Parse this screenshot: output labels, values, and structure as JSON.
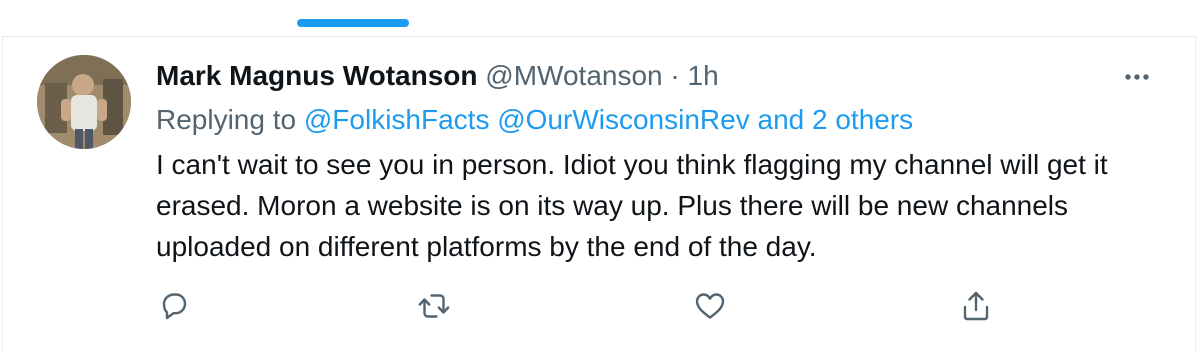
{
  "tweet": {
    "display_name": "Mark Magnus Wotanson",
    "handle": "@MWotanson",
    "separator": "·",
    "time": "1h",
    "replying_prefix": "Replying to",
    "mention_1": "@FolkishFacts",
    "mention_2": "@OurWisconsinRev",
    "mention_more": "and 2 others",
    "body": "I can't wait to see you in person. Idiot you think flagging my channel will get it erased. Moron a website is on its way up. Plus there will be new channels uploaded on different platforms by the end of the day."
  },
  "icons": {
    "more": "more-options-icon",
    "reply": "reply-icon",
    "retweet": "retweet-icon",
    "like": "like-icon",
    "share": "share-icon"
  },
  "colors": {
    "accent": "#1d9bf0",
    "secondary_text": "#536471",
    "primary_text": "#0f1419",
    "border": "#e6ecf0"
  }
}
